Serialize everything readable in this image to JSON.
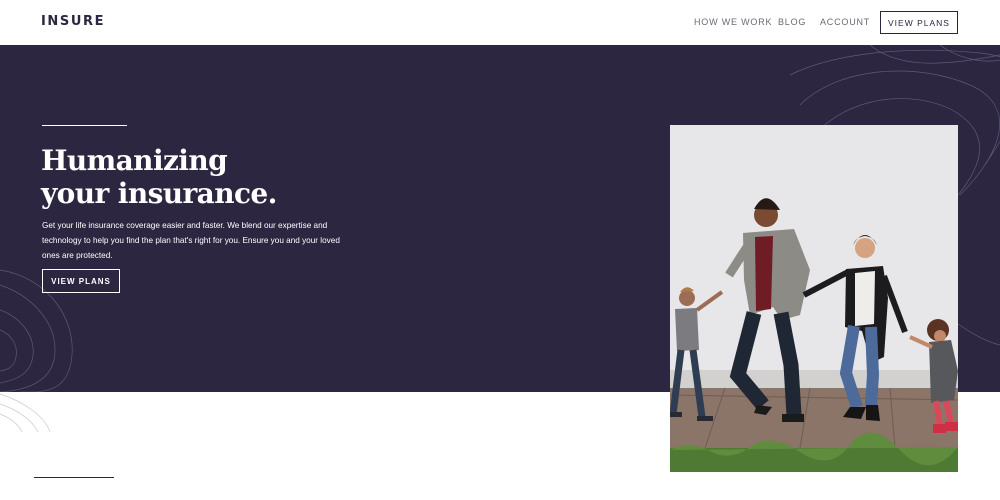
{
  "header": {
    "logo": "INSURE",
    "nav": [
      "HOW WE WORK",
      "BLOG",
      "ACCOUNT"
    ],
    "cta": "VIEW PLANS"
  },
  "hero": {
    "title_line1": "Humanizing",
    "title_line2": "your insurance.",
    "text": "Get your life insurance coverage easier and faster. We blend our expertise and technology to help you find the plan that's right for you. Ensure you and your loved ones are protected.",
    "cta": "VIEW PLANS"
  },
  "colors": {
    "dark_violet": "#2c2640",
    "white": "#ffffff",
    "nav_gray": "#6d6877"
  },
  "icons": [
    "topographic-pattern-icon"
  ]
}
